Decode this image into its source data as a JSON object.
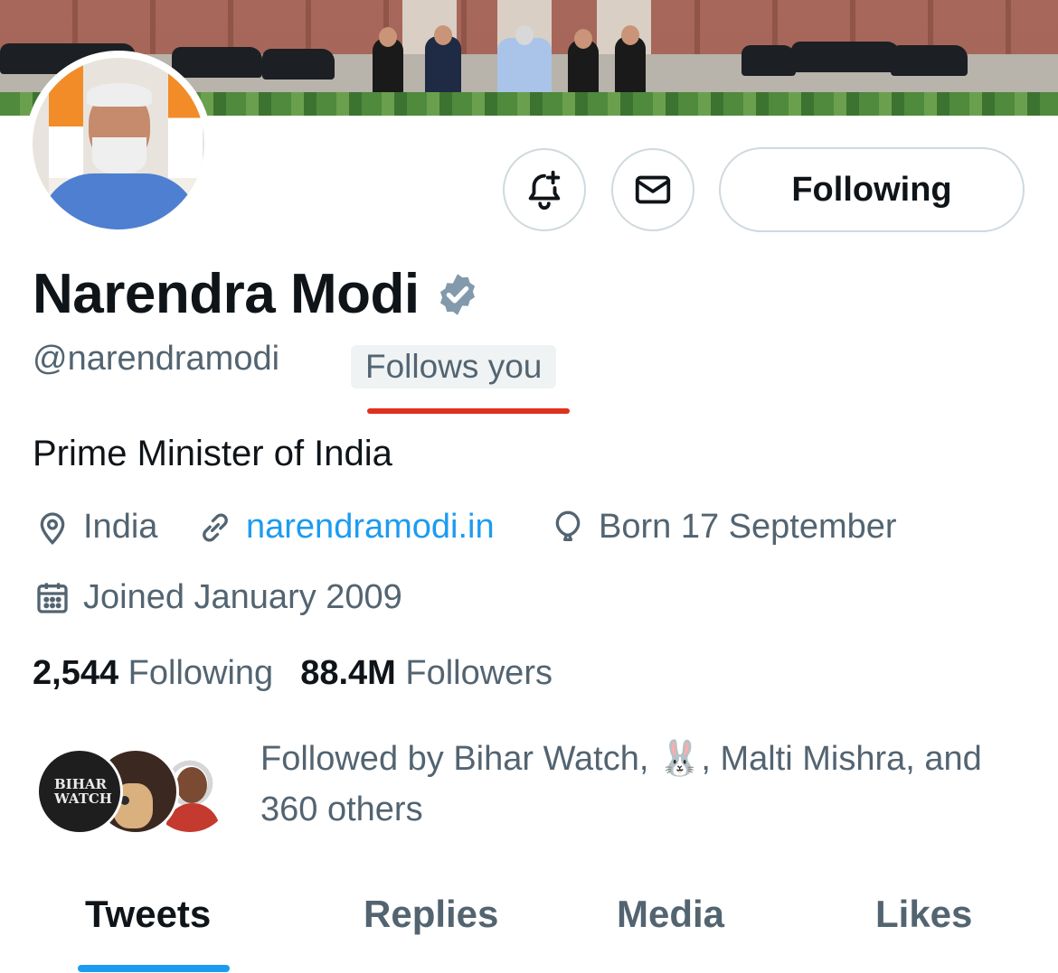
{
  "profile": {
    "name": "Narendra Modi",
    "handle": "@narendramodi",
    "follows_you": "Follows you",
    "bio": "Prime Minister of India",
    "location": "India",
    "website": "narendramodi.in",
    "birthday": "Born 17 September",
    "joined": "Joined January 2009"
  },
  "actions": {
    "following_label": "Following"
  },
  "stats": {
    "following_count": "2,544",
    "following_label": "Following",
    "followers_count": "88.4M",
    "followers_label": "Followers"
  },
  "followed_by": {
    "text_before": "Followed by Bihar Watch,",
    "emoji": "🐰",
    "text_after": ", Malti Mishra, and 360 others",
    "avatar_1_text": "BIHAR WATCH"
  },
  "tabs": [
    {
      "label": "Tweets",
      "active": true
    },
    {
      "label": "Replies",
      "active": false
    },
    {
      "label": "Media",
      "active": false
    },
    {
      "label": "Likes",
      "active": false
    }
  ],
  "colors": {
    "accent": "#1d9bf0",
    "highlight_underline": "#e0301e",
    "muted": "#536471",
    "verified": "#829aab"
  },
  "icons": {
    "notify": "bell-plus-icon",
    "message": "envelope-icon",
    "verified": "verified-badge-icon",
    "location": "location-pin-icon",
    "link": "link-icon",
    "birthday": "balloon-icon",
    "joined": "calendar-icon"
  }
}
